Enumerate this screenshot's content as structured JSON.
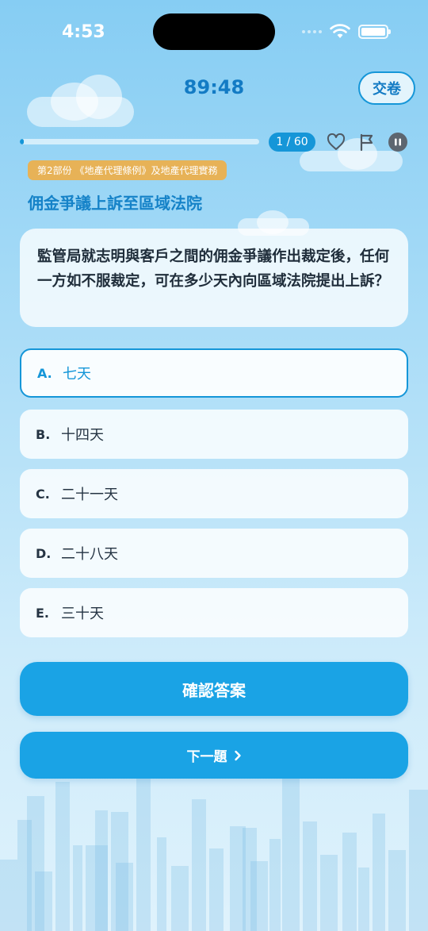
{
  "status_bar": {
    "time": "4:53"
  },
  "header": {
    "timer": "89:48",
    "submit_label": "交卷"
  },
  "progress": {
    "label": "1 / 60",
    "fraction": 0.0167
  },
  "section_badge": "第2部份 《地產代理條例》及地產代理實務",
  "topic_title": "佣金爭議上訴至區域法院",
  "question": "監管局就志明與客戶之間的佣金爭議作出裁定後，任何一方如不服裁定，可在多少天內向區域法院提出上訴？",
  "options": [
    {
      "letter": "A.",
      "text": "七天",
      "selected": true
    },
    {
      "letter": "B.",
      "text": "十四天",
      "selected": false
    },
    {
      "letter": "C.",
      "text": "二十一天",
      "selected": false
    },
    {
      "letter": "D.",
      "text": "二十八天",
      "selected": false
    },
    {
      "letter": "E.",
      "text": "三十天",
      "selected": false
    }
  ],
  "buttons": {
    "confirm": "確認答案",
    "next": "下一題"
  },
  "icons": [
    "heart-icon",
    "flag-icon",
    "pause-icon",
    "chevron-right-icon",
    "wifi-icon",
    "battery-icon"
  ],
  "colors": {
    "accent": "#1596d8",
    "badge": "#e7b257"
  }
}
